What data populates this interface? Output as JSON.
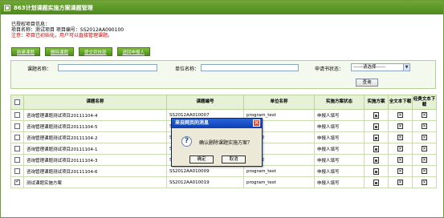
{
  "window": {
    "title": "863计划课题实施方案课题管理"
  },
  "info": {
    "heading": "已授权项目信息：",
    "project_line": "项目名称：测试项目  项目编号：SS2012AA090100",
    "warning": "注意：项目已初始化，用户可以直接管理课题。"
  },
  "toolbar": {
    "new_label": "新建课题",
    "delete_label": "删除课题",
    "submit_label": "提交到技部",
    "return_label": "退回申报人"
  },
  "search": {
    "topic_label": "课题名称：",
    "unit_label": "单位名称：",
    "status_label": "申请书状态：",
    "status_selected": "------请选择------",
    "query_label": "查询"
  },
  "table": {
    "headers": [
      "课题名称",
      "课题编号",
      "单位名称",
      "实施方案状态",
      "实施方案",
      "全文本下载",
      "经费文本下载"
    ],
    "rows": [
      {
        "name": "咨询管理课题测试项目20111104-4",
        "code": "SS2012AA010007",
        "unit": "program_test",
        "status": "申报人填写",
        "checked": false
      },
      {
        "name": "咨询管理课题测试项目20111104-5",
        "code": "SS2012AA010",
        "unit": "m_test",
        "status": "申报人填写",
        "checked": false
      },
      {
        "name": "咨询管理课题测试项目20111104-2",
        "code": "SS2012AA010",
        "unit": "m_test2",
        "status": "申报人填写",
        "checked": false
      },
      {
        "name": "咨询管理课题测试项目20111104-1",
        "code": "SS2012AA010",
        "unit": "m_test",
        "status": "申报人填写",
        "checked": false
      },
      {
        "name": "咨询管理课题测试项目20111104-3",
        "code": "SS2012AA010",
        "unit": "m_test2",
        "status": "申报人填写",
        "checked": false
      },
      {
        "name": "咨询管理课题测试项目20111104-6",
        "code": "SS2012AA010009",
        "unit": "program_test",
        "status": "申报人填写",
        "checked": false
      },
      {
        "name": "测试课题实施方案",
        "code": "SS2012AA010019",
        "unit": "program_test",
        "status": "申报人填写",
        "checked": true
      }
    ]
  },
  "dialog": {
    "title": "来自网页的消息",
    "message": "确认删除课题实施方案？",
    "ok_label": "确定",
    "cancel_label": "取消"
  },
  "colors": {
    "title_green": "#5a9628",
    "dialog_blue": "#0b3fb5",
    "warning_red": "#d00000"
  },
  "icons": {
    "doc": "document-icon",
    "download": "x-box-icon",
    "question": "question-icon"
  }
}
